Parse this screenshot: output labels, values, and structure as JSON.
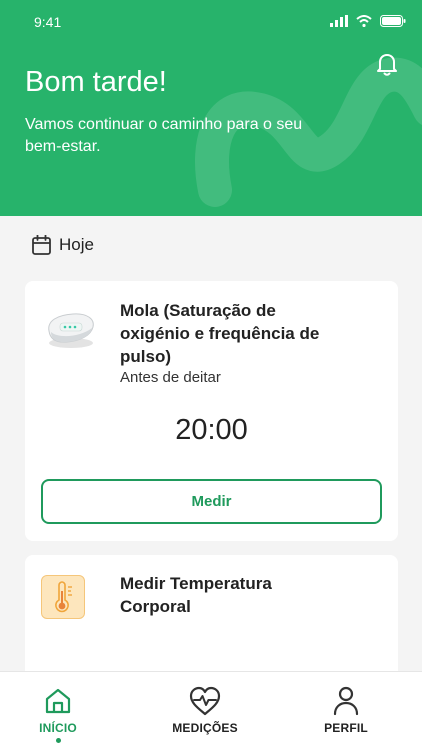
{
  "status_bar": {
    "time": "9:41"
  },
  "header": {
    "greeting": "Bom tarde!",
    "subtitle": "Vamos continuar o caminho para o seu bem-estar."
  },
  "today": {
    "label": "Hoje"
  },
  "cards": [
    {
      "title": "Mola (Saturação de oxigénio e frequência de pulso)",
      "subtitle": "Antes de deitar",
      "time": "20:00",
      "button_label": "Medir",
      "icon": "pulse-oximeter-icon"
    },
    {
      "title": "Medir Temperatura Corporal",
      "icon": "thermometer-icon"
    }
  ],
  "bottom_nav": {
    "items": [
      {
        "label": "INÍCIO",
        "icon": "home-icon",
        "active": true
      },
      {
        "label": "MEDIÇÕES",
        "icon": "heart-pulse-icon",
        "active": false
      },
      {
        "label": "PERFIL",
        "icon": "person-icon",
        "active": false
      }
    ]
  },
  "colors": {
    "brand_green": "#27b36b",
    "accent_green": "#1f9a5c",
    "background": "#f4f4f4",
    "thermo_bg": "#fde6bd"
  }
}
